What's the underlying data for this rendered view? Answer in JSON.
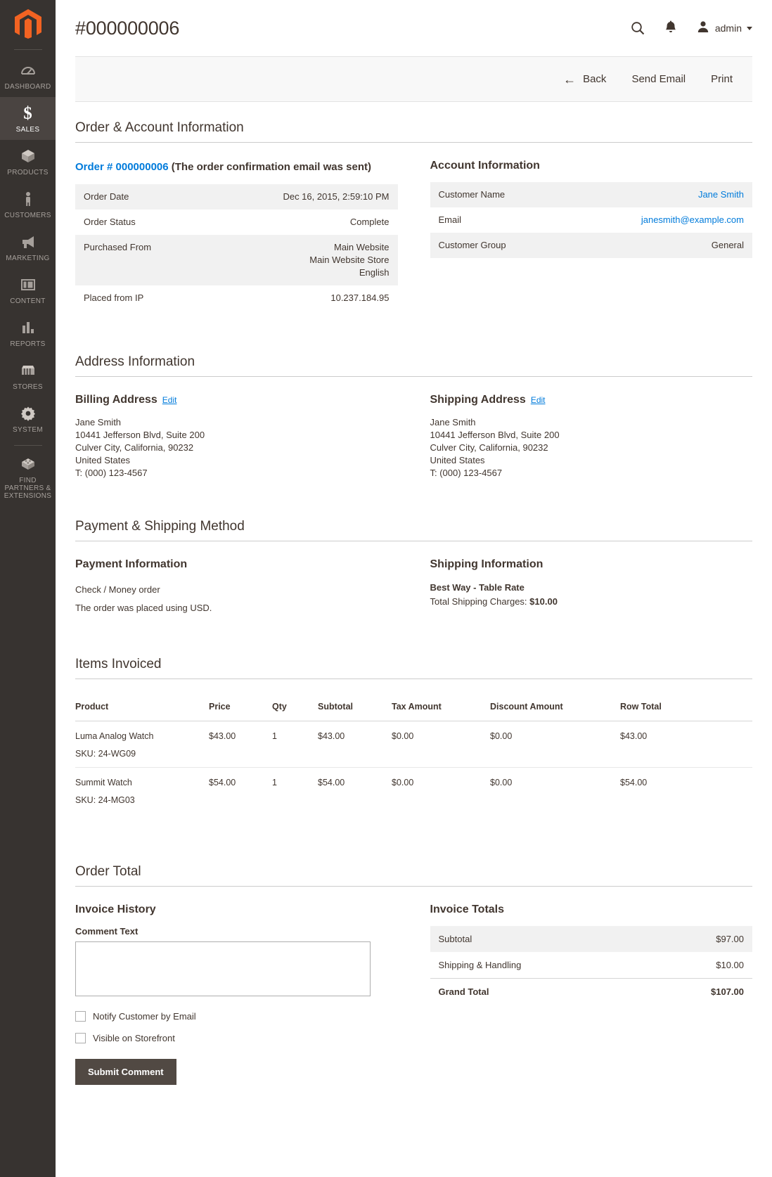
{
  "sidebar": {
    "logo_name": "magento-logo",
    "items": [
      {
        "label": "DASHBOARD",
        "icon": "dashboard-icon",
        "active": false
      },
      {
        "label": "SALES",
        "icon": "dollar-icon",
        "active": true
      },
      {
        "label": "PRODUCTS",
        "icon": "products-box-icon",
        "active": false
      },
      {
        "label": "CUSTOMERS",
        "icon": "customers-person-icon",
        "active": false
      },
      {
        "label": "MARKETING",
        "icon": "megaphone-icon",
        "active": false
      },
      {
        "label": "CONTENT",
        "icon": "content-layout-icon",
        "active": false
      },
      {
        "label": "REPORTS",
        "icon": "bar-chart-icon",
        "active": false
      },
      {
        "label": "STORES",
        "icon": "storefront-icon",
        "active": false
      },
      {
        "label": "SYSTEM",
        "icon": "gear-icon",
        "active": false
      },
      {
        "label": "FIND PARTNERS & EXTENSIONS",
        "icon": "extension-block-icon",
        "active": false
      }
    ]
  },
  "header": {
    "title": "#000000006",
    "search_icon": "search-icon",
    "notifications_icon": "bell-icon",
    "account_icon": "user-avatar-icon",
    "account_label": "admin"
  },
  "toolbar": {
    "back_label": "Back",
    "back_icon": "arrow-left-icon",
    "send_email_label": "Send Email",
    "print_label": "Print"
  },
  "order_account": {
    "section_title": "Order & Account Information",
    "order_link_label": "Order # 000000006",
    "order_status_note": " (The order confirmation email was sent)",
    "rows": [
      {
        "label": "Order Date",
        "value": "Dec 16, 2015, 2:59:10 PM"
      },
      {
        "label": "Order Status",
        "value": "Complete"
      },
      {
        "label": "Purchased From",
        "value": [
          "Main Website",
          "Main Website Store",
          "English"
        ]
      },
      {
        "label": "Placed from IP",
        "value": "10.237.184.95"
      }
    ],
    "account_title": "Account Information",
    "account_rows": [
      {
        "label": "Customer Name",
        "value": "Jane Smith",
        "link": true
      },
      {
        "label": "Email",
        "value": "janesmith@example.com",
        "link": true
      },
      {
        "label": "Customer Group",
        "value": "General",
        "link": false
      }
    ]
  },
  "address": {
    "section_title": "Address Information",
    "billing_title": "Billing Address",
    "billing_edit": "Edit",
    "billing_lines": [
      "Jane Smith",
      "10441 Jefferson Blvd, Suite 200",
      "Culver City, California, 90232",
      "United States",
      "T: (000) 123-4567"
    ],
    "shipping_title": "Shipping Address",
    "shipping_edit": "Edit",
    "shipping_lines": [
      "Jane Smith",
      "10441 Jefferson Blvd, Suite 200",
      "Culver City, California, 90232",
      "United States",
      "T: (000) 123-4567"
    ]
  },
  "payment_shipping": {
    "section_title": "Payment & Shipping Method",
    "payment_title": "Payment Information",
    "payment_method": "Check / Money order",
    "payment_currency_note": "The order was placed using USD.",
    "shipping_title": "Shipping Information",
    "shipping_method": "Best Way - Table Rate",
    "shipping_charges_label": "Total Shipping Charges: ",
    "shipping_charges_value": "$10.00"
  },
  "items": {
    "section_title": "Items Invoiced",
    "columns": [
      "Product",
      "Price",
      "Qty",
      "Subtotal",
      "Tax Amount",
      "Discount Amount",
      "Row Total"
    ],
    "rows": [
      {
        "product": "Luma Analog Watch",
        "sku": "SKU: 24-WG09",
        "price": "$43.00",
        "qty": "1",
        "subtotal": "$43.00",
        "tax": "$0.00",
        "discount": "$0.00",
        "row_total": "$43.00"
      },
      {
        "product": "Summit Watch",
        "sku": "SKU: 24-MG03",
        "price": "$54.00",
        "qty": "1",
        "subtotal": "$54.00",
        "tax": "$0.00",
        "discount": "$0.00",
        "row_total": "$54.00"
      }
    ]
  },
  "order_total": {
    "section_title": "Order Total",
    "history_title": "Invoice History",
    "comment_label": "Comment Text",
    "comment_value": "",
    "comment_placeholder": "",
    "notify_label": "Notify Customer by Email",
    "visible_label": "Visible on Storefront",
    "submit_label": "Submit Comment",
    "totals_title": "Invoice Totals",
    "totals_rows": [
      {
        "label": "Subtotal",
        "value": "$97.00",
        "grand": false
      },
      {
        "label": "Shipping & Handling",
        "value": "$10.00",
        "grand": false
      },
      {
        "label": "Grand Total",
        "value": "$107.00",
        "grand": true
      }
    ]
  },
  "colors": {
    "sidebar_bg": "#373330",
    "sidebar_active": "#4a4441",
    "accent_link": "#007bdb",
    "brand_orange": "#f26322",
    "text": "#41362f",
    "button_dark": "#514943"
  }
}
